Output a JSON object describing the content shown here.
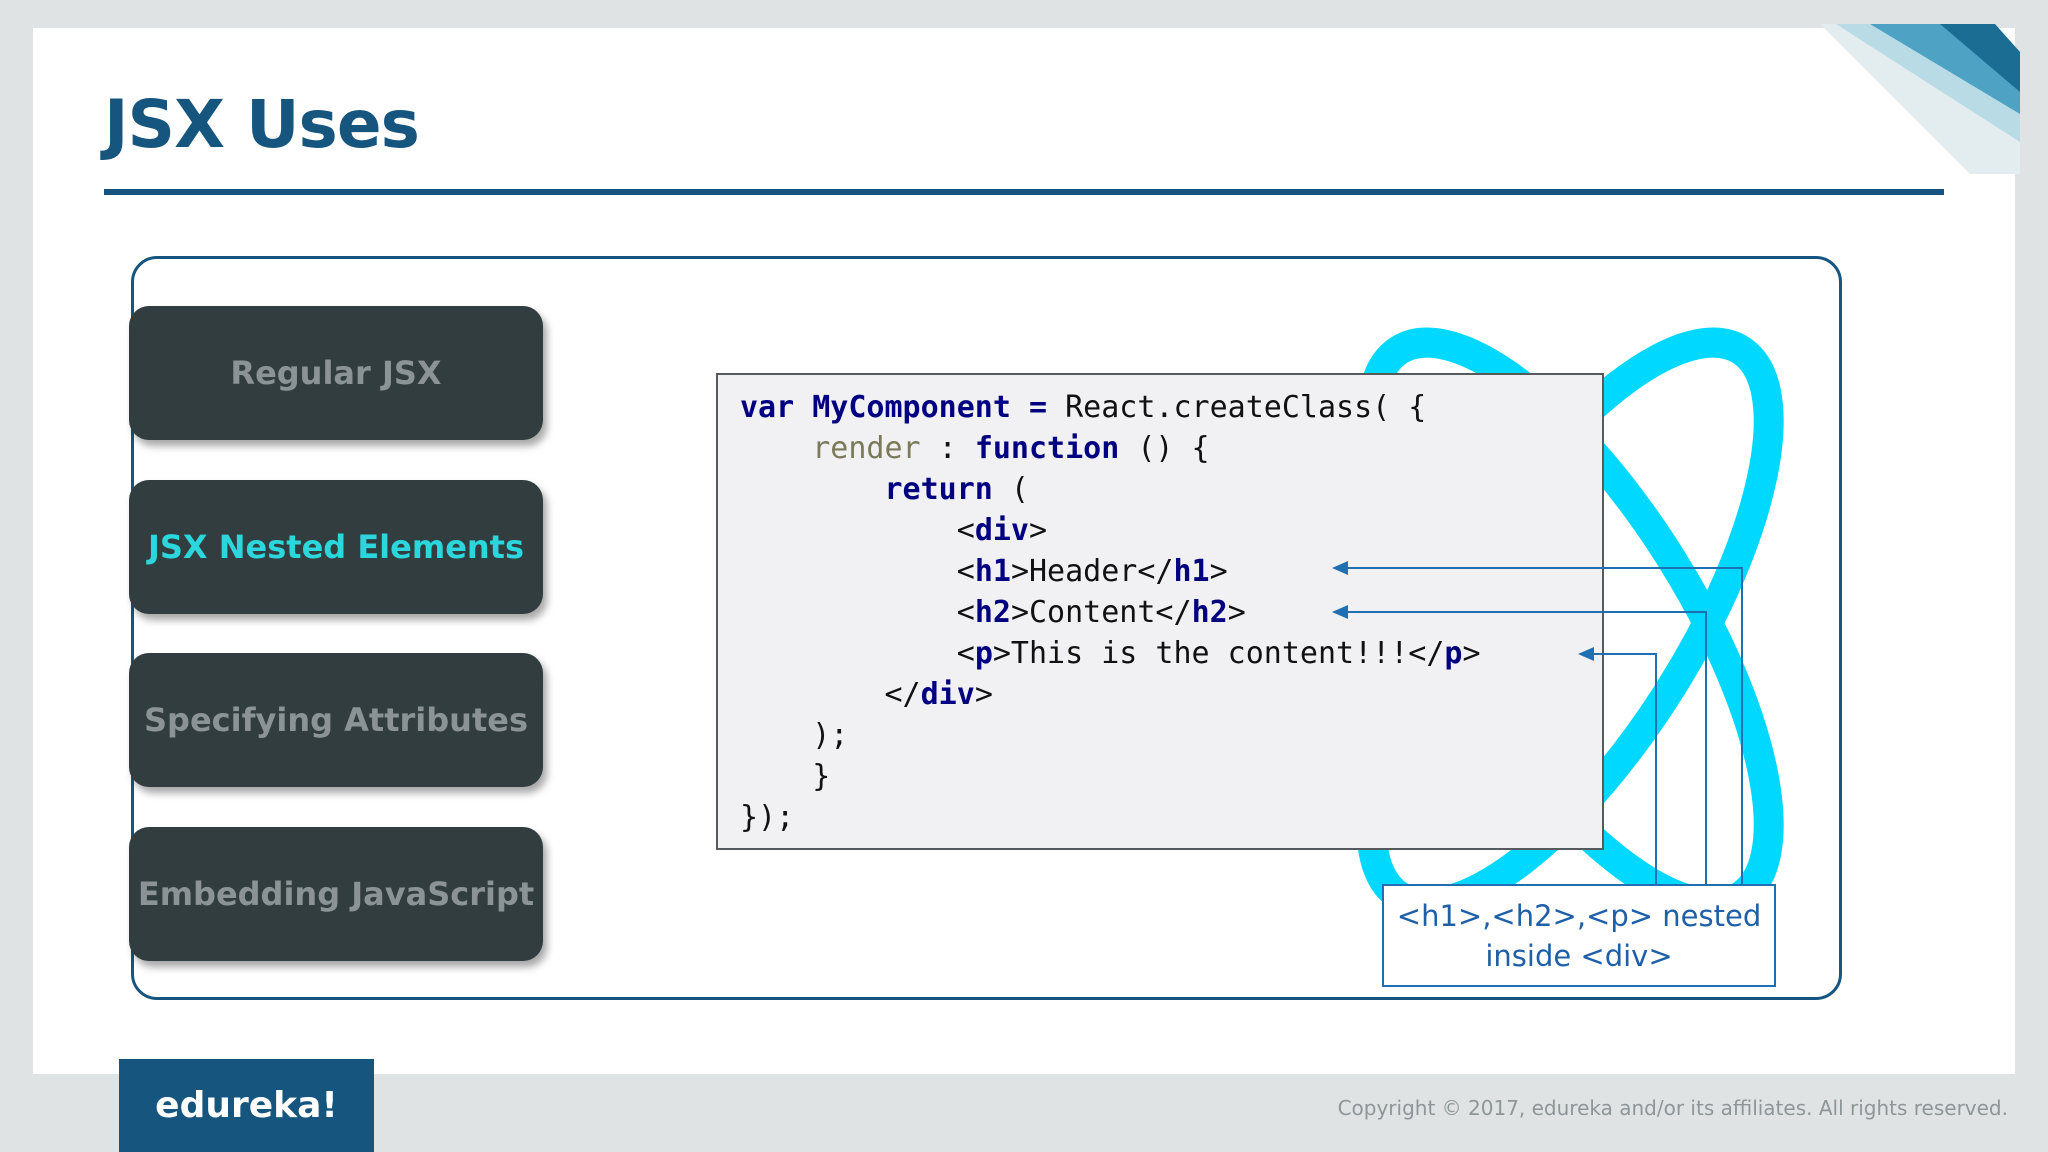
{
  "slide": {
    "title": "JSX Uses"
  },
  "menu": [
    {
      "label": "Regular JSX",
      "active": false
    },
    {
      "label": "JSX Nested Elements",
      "active": true
    },
    {
      "label": "Specifying Attributes",
      "active": false
    },
    {
      "label": "Embedding JavaScript",
      "active": false
    }
  ],
  "code": {
    "l1_var": "var",
    "l1_name": "MyComponent",
    "l1_eq": "=",
    "l1_rest": "React.createClass( {",
    "l2_render": "render",
    "l2_colon": " : ",
    "l2_function": "function",
    "l2_rest": " () {",
    "l3_return": "return",
    "l3_rest": " (",
    "l4_open": "<",
    "l4_tag": "div",
    "l4_close": ">",
    "l5_a": "<",
    "l5_tag1": "h1",
    "l5_text": ">Header</",
    "l5_tag2": "h1",
    "l5_c": ">",
    "l6_a": "<",
    "l6_tag1": "h2",
    "l6_text": ">Content</",
    "l6_tag2": "h2",
    "l6_c": ">",
    "l7_a": "<",
    "l7_tag1": "p",
    "l7_text": ">This is the content!!!</",
    "l7_tag2": "p",
    "l7_c": ">",
    "l8_a": "</",
    "l8_tag": "div",
    "l8_c": ">",
    "l9": ");",
    "l10": "}",
    "l11": "});"
  },
  "note": {
    "line1": "<h1>,<h2>,<p> nested",
    "line2": "inside <div>"
  },
  "footer": {
    "brand": "edureka!",
    "copyright": "Copyright © 2017, edureka and/or its affiliates. All rights reserved."
  },
  "colors": {
    "title": "#16557d",
    "logo": "#00d8ff",
    "button_bg": "#323d40",
    "button_active_text": "#2bd7dc",
    "arrow": "#1f6fb3"
  }
}
